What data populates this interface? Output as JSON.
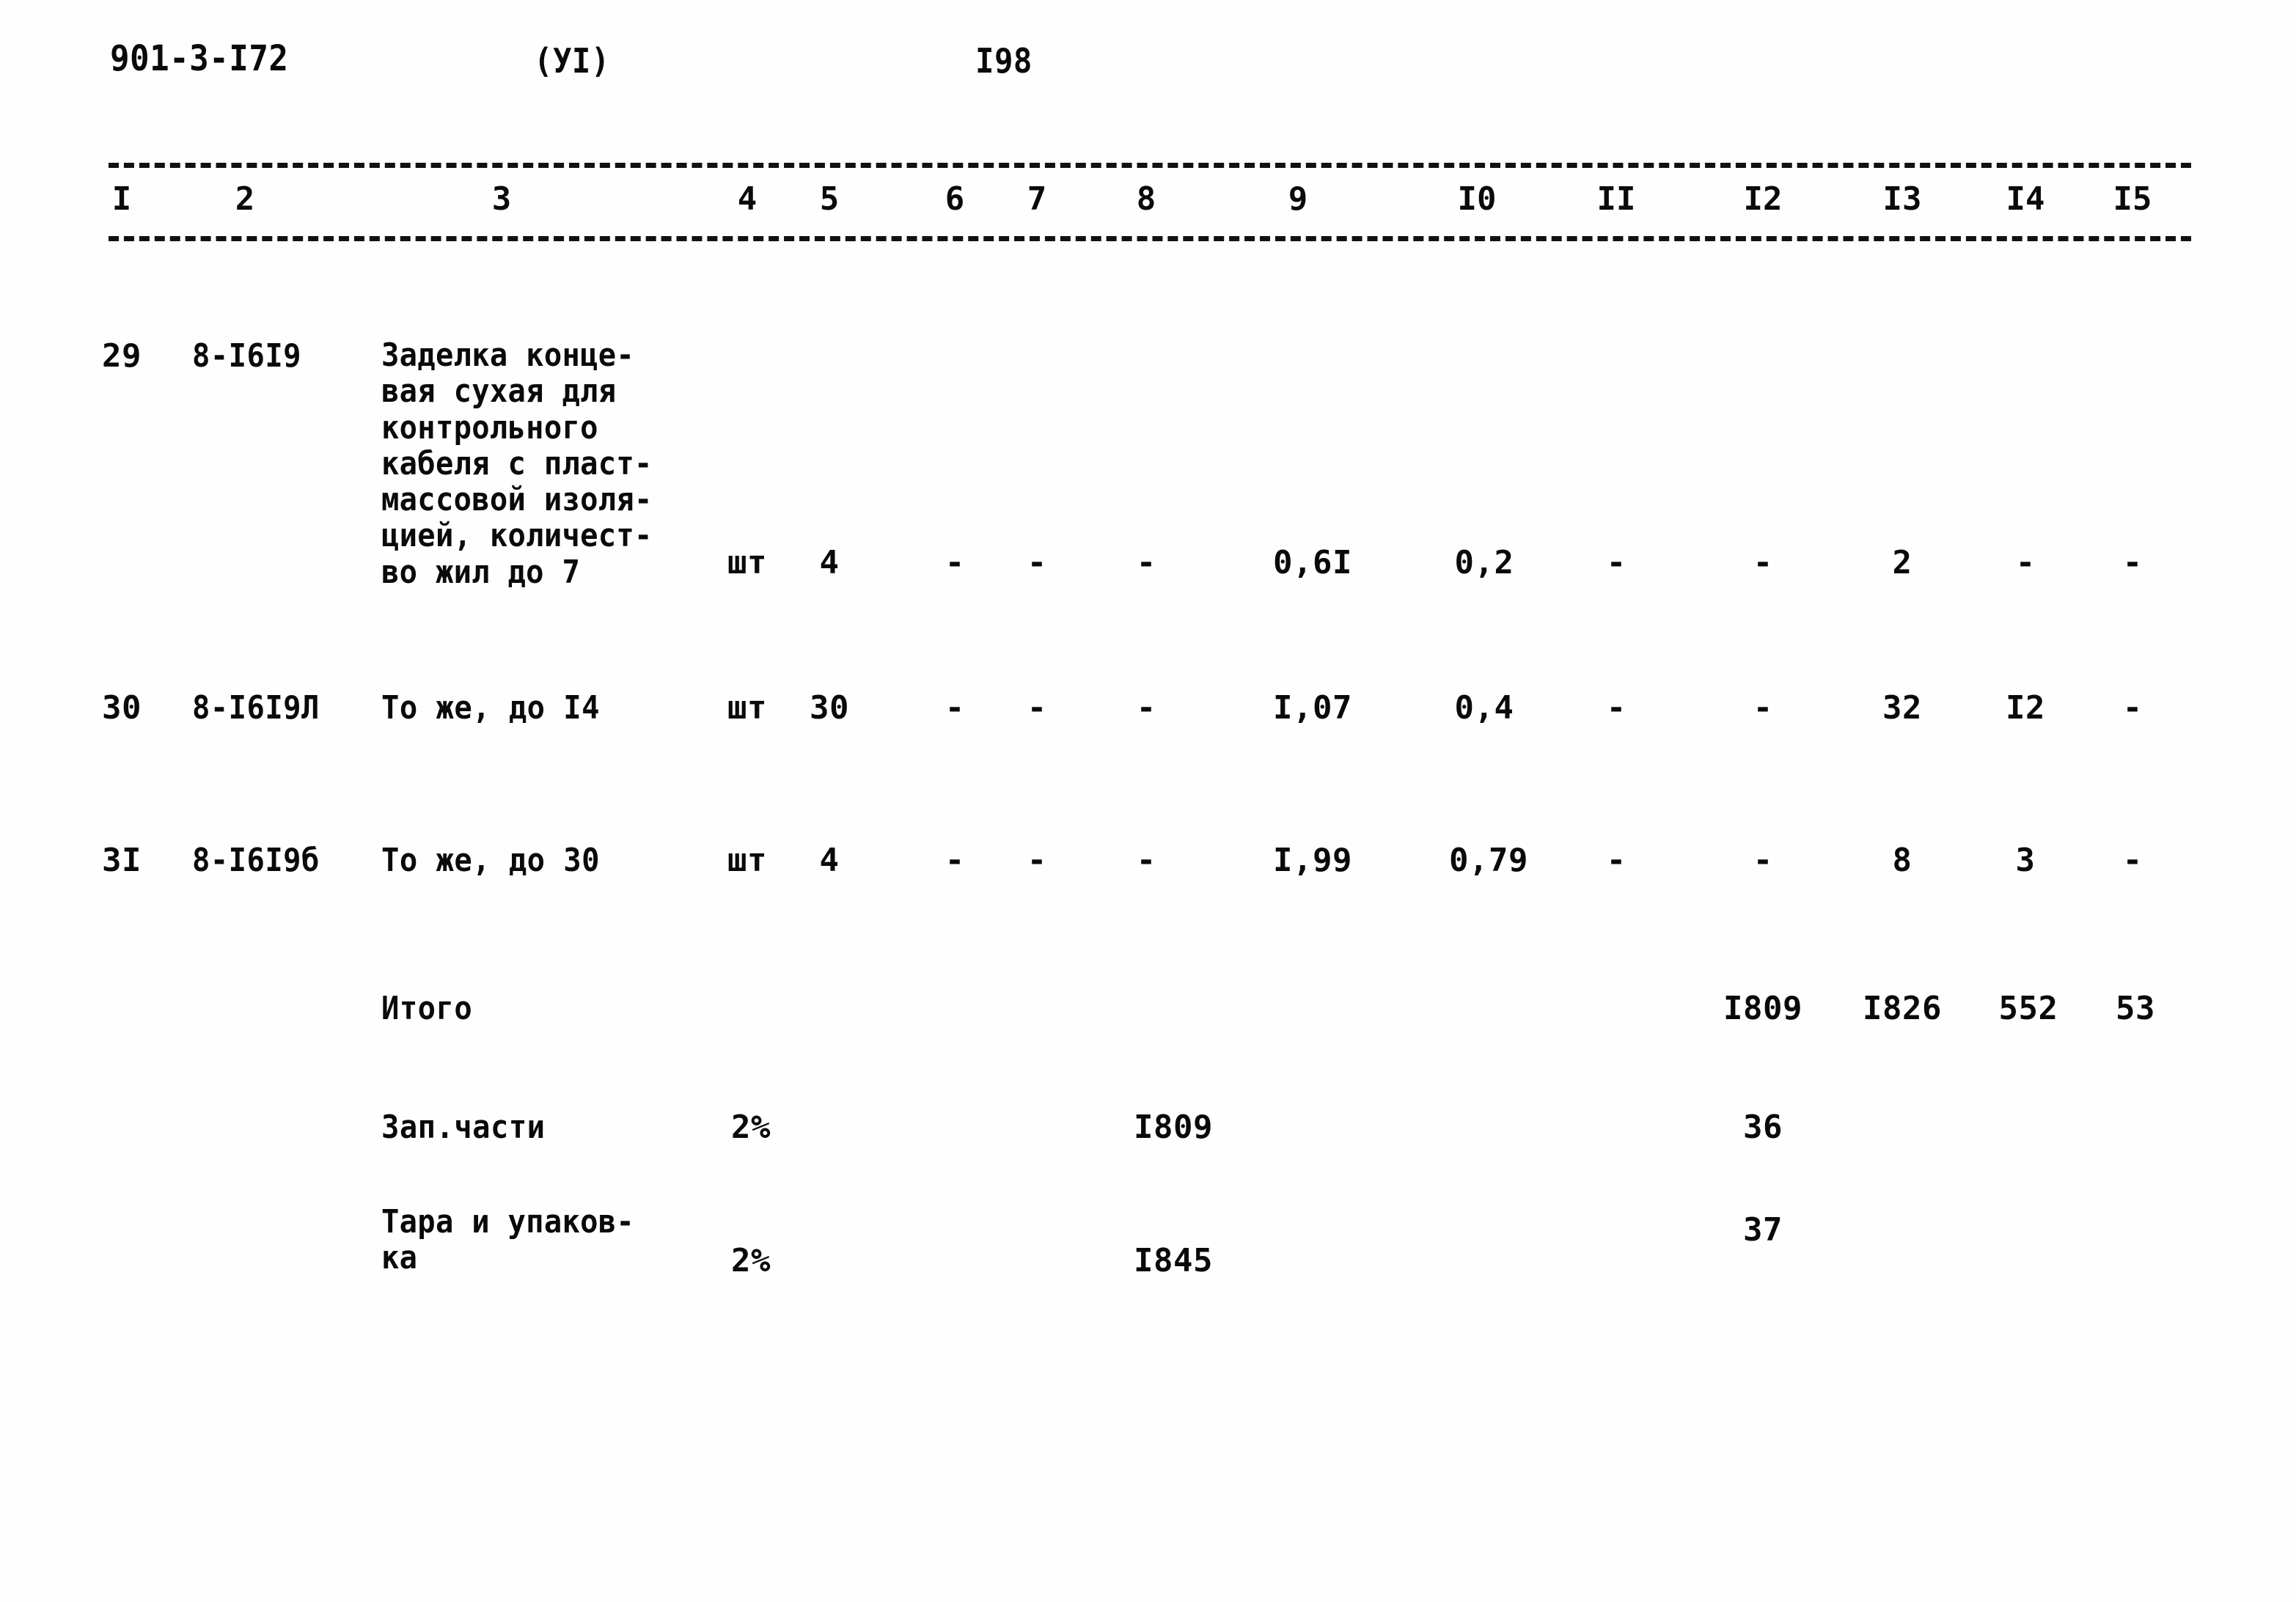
{
  "document": {
    "code": "901-3-I72",
    "section": "(УI)",
    "page_number": "I98"
  },
  "table": {
    "column_headers": [
      "I",
      "2",
      "3",
      "4",
      "5",
      "6",
      "7",
      "8",
      "9",
      "I0",
      "II",
      "I2",
      "I3",
      "I4",
      "I5"
    ],
    "rows": [
      {
        "id": "row-29",
        "c1": "29",
        "c2": "8-I6I9",
        "c3": "Заделка конце-\nвая сухая для\nконтрольного\nкабеля с пласт-\nмассовой изоля-\nцией, количест-\nво жил до 7",
        "c4": "шт",
        "c5": "4",
        "c6": "-",
        "c7": "-",
        "c8": "-",
        "c9": "0,6I",
        "c10": "0,2",
        "c11": "-",
        "c12": "-",
        "c13": "2",
        "c14": "-",
        "c15": "-"
      },
      {
        "id": "row-30",
        "c1": "30",
        "c2": "8-I6I9Л",
        "c3": "То же, до I4",
        "c4": "шт",
        "c5": "30",
        "c6": "-",
        "c7": "-",
        "c8": "-",
        "c9": "I,07",
        "c10": "0,4",
        "c11": "-",
        "c12": "-",
        "c13": "32",
        "c14": "I2",
        "c15": "-"
      },
      {
        "id": "row-31",
        "c1": "3I",
        "c2": "8-I6I9б",
        "c3": "То же, до 30",
        "c4": "шт",
        "c5": "4",
        "c6": "-",
        "c7": "-",
        "c8": "-",
        "c9": "I,99",
        "c10": "0,79",
        "c11": "-",
        "c12": "-",
        "c13": "8",
        "c14": "3",
        "c15": "-"
      }
    ],
    "summary_rows": [
      {
        "id": "row-total",
        "label": "Итого",
        "c4": "",
        "c8": "",
        "c12": "I809",
        "c13": "I826",
        "c14": "552",
        "c15": "53"
      },
      {
        "id": "row-spare-parts",
        "label": "Зап.части",
        "c4": "2%",
        "c8": "I809",
        "c12": "36",
        "c13": "",
        "c14": "",
        "c15": ""
      },
      {
        "id": "row-packaging",
        "label": "Тара и упаков-\nка",
        "c4": "2%",
        "c8": "I845",
        "c12": "37",
        "c13": "",
        "c14": "",
        "c15": ""
      }
    ]
  }
}
